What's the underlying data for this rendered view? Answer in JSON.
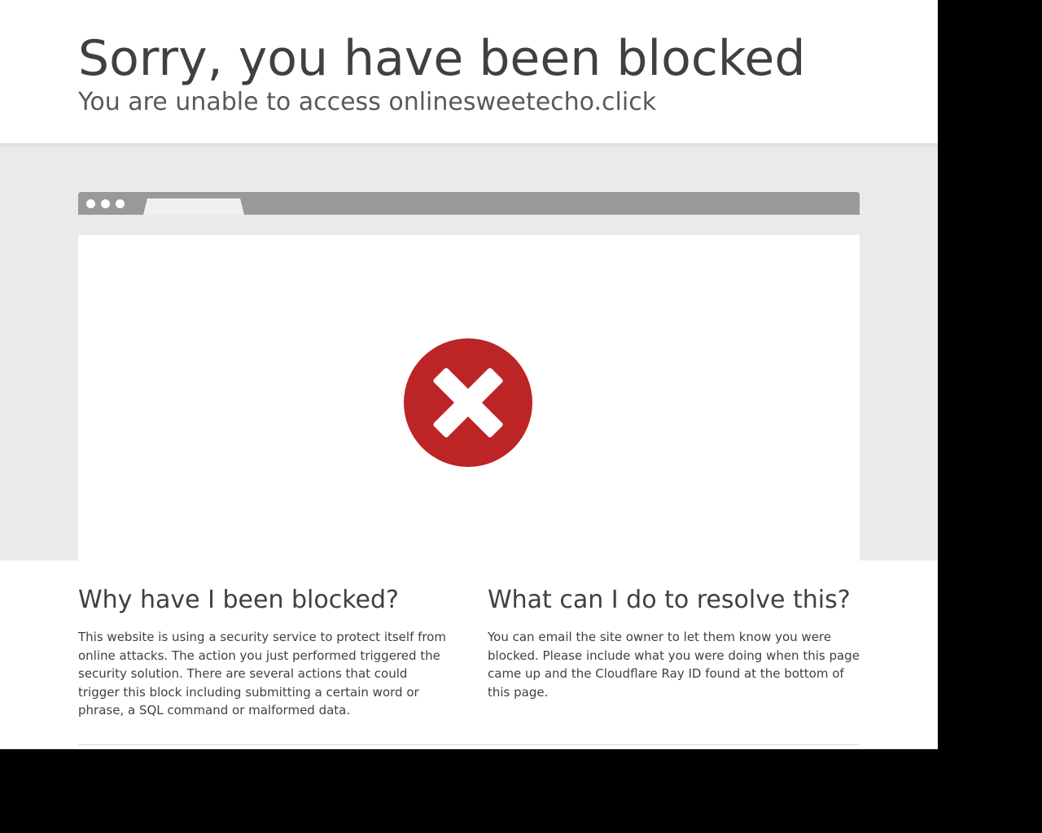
{
  "header": {
    "title": "Sorry, you have been blocked",
    "subtitle": "You are unable to access onlinesweetecho.click"
  },
  "illustration": {
    "icon": "error-x-circle-icon",
    "icon_color": "#bd2426"
  },
  "sections": [
    {
      "heading": "Why have I been blocked?",
      "body": "This website is using a security service to protect itself from online attacks. The action you just performed triggered the security solution. There are several actions that could trigger this block including submitting a certain word or phrase, a SQL command or malformed data."
    },
    {
      "heading": "What can I do to resolve this?",
      "body": "You can email the site owner to let them know you were blocked. Please include what you were doing when this page came up and the Cloudflare Ray ID found at the bottom of this page."
    }
  ]
}
